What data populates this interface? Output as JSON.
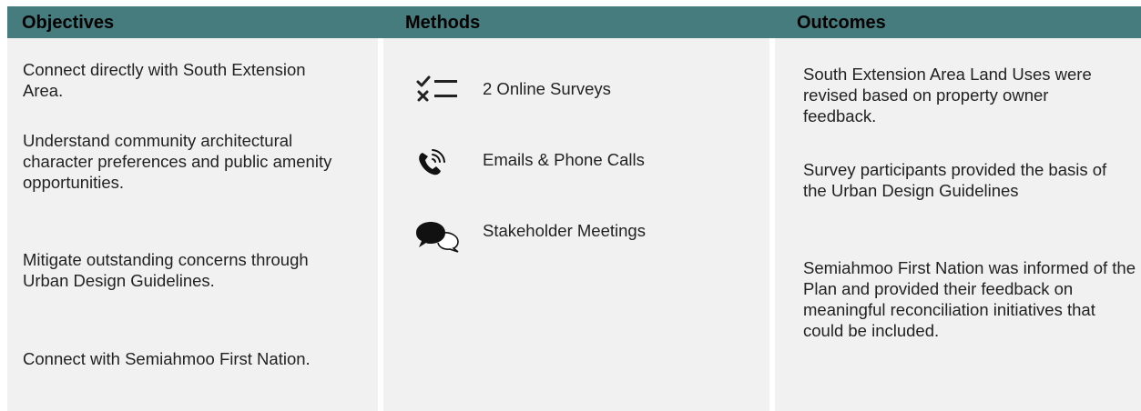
{
  "headers": {
    "objectives": "Objectives",
    "methods": "Methods",
    "outcomes": "Outcomes"
  },
  "objectives": [
    "Connect directly with South Extension Area.",
    "Understand community architectural character preferences and public amenity opportunities.",
    "Mitigate outstanding concerns through Urban Design Guidelines.",
    "Connect with Semiahmoo First Nation."
  ],
  "methods": [
    {
      "icon": "checklist-icon",
      "label": "2 Online Surveys"
    },
    {
      "icon": "phone-call-icon",
      "label": "Emails & Phone Calls"
    },
    {
      "icon": "chat-bubbles-icon",
      "label": "Stakeholder Meetings"
    }
  ],
  "outcomes": [
    "South Extension Area Land Uses were revised based on property owner feedback.",
    "Survey participants provided the basis of the Urban Design Guidelines",
    "Semiahmoo First Nation was informed of the Plan and provided their feedback on meaningful reconciliation initiatives that could be included."
  ],
  "colors": {
    "header_band": "#467c7e",
    "column_bg": "#f1f1f1",
    "text": "#222222"
  }
}
